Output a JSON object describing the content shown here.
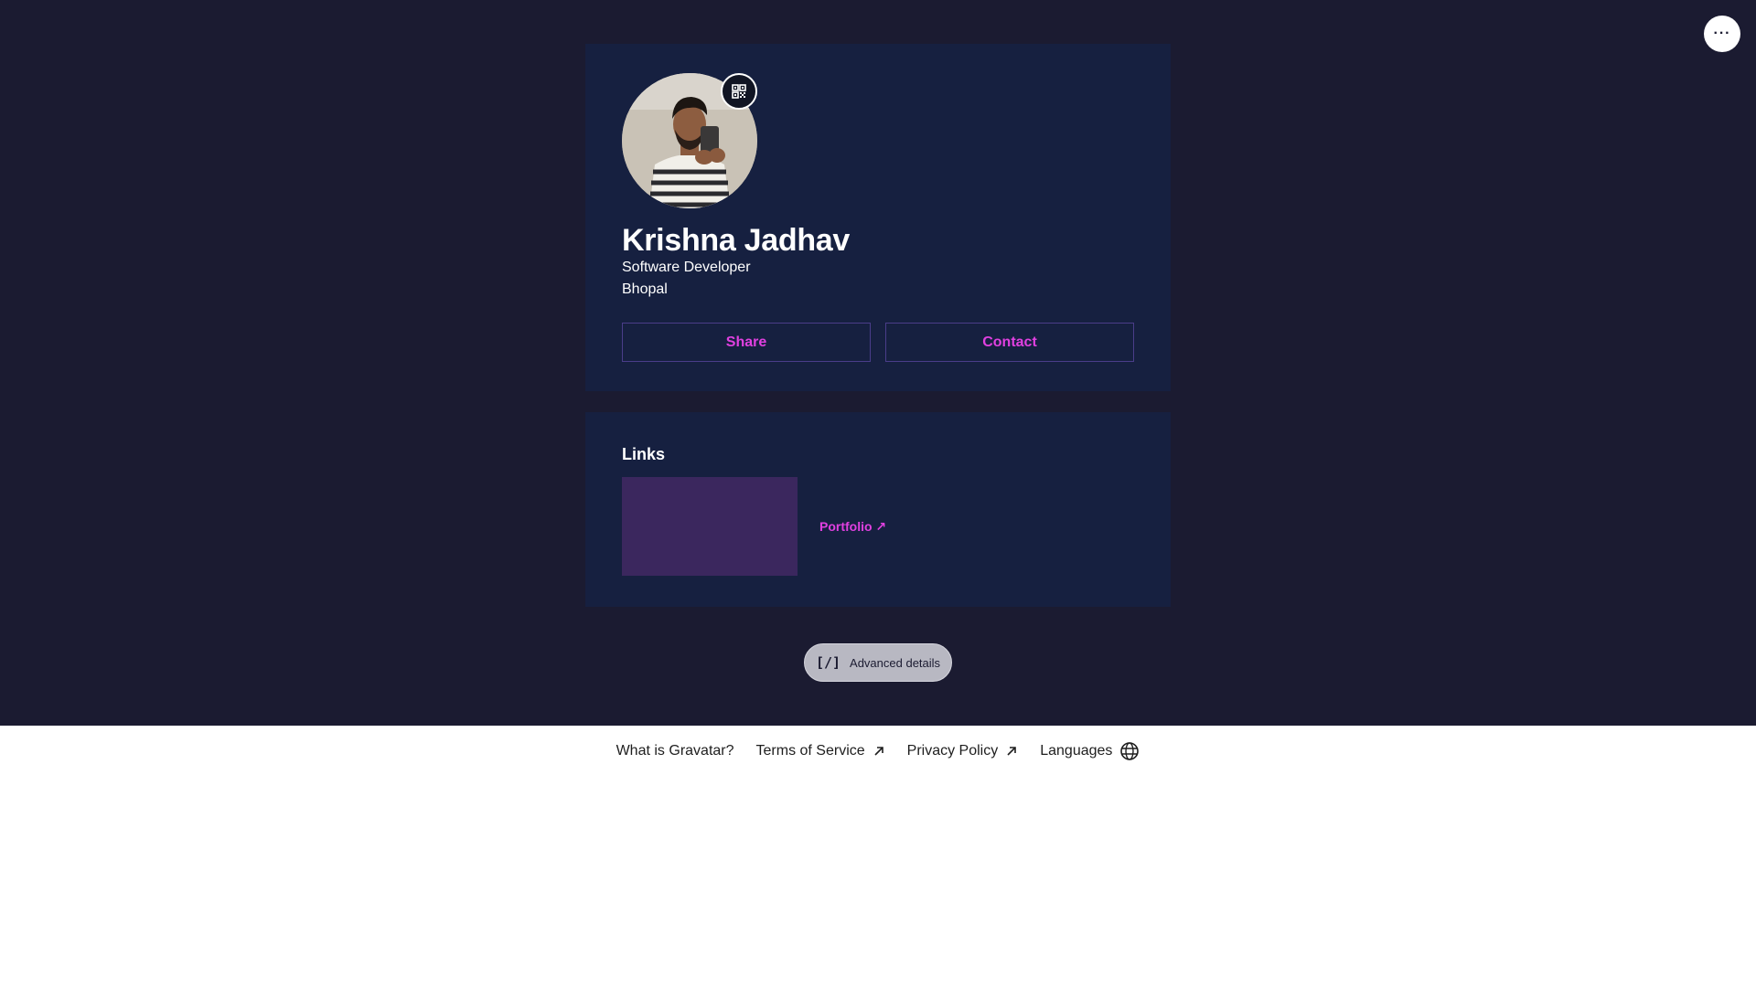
{
  "header": {
    "more_icon": "more-horizontal-icon",
    "more_label": "···"
  },
  "profile": {
    "avatar_alt": "avatar",
    "qr_icon": "qr-code-icon",
    "name": "Krishna Jadhav",
    "job_title": "Software Developer",
    "location": "Bhopal",
    "share_label": "Share",
    "contact_label": "Contact",
    "accent_color": "#e040e0"
  },
  "links": {
    "title": "Links",
    "items": [
      {
        "label": "Portfolio ↗",
        "thumb_color": "#3b275e"
      }
    ]
  },
  "advanced": {
    "icon": "[/]",
    "label": "Advanced details"
  },
  "footer": {
    "items": [
      {
        "label": "What is Gravatar?",
        "icon": ""
      },
      {
        "label": "Terms of Service",
        "icon": "external-arrow-icon"
      },
      {
        "label": "Privacy Policy",
        "icon": "external-arrow-icon"
      },
      {
        "label": "Languages",
        "icon": "globe-icon"
      }
    ]
  },
  "colors": {
    "page_background": "#1b1b31",
    "card_background": "#162040",
    "footer_background": "#ffffff"
  }
}
